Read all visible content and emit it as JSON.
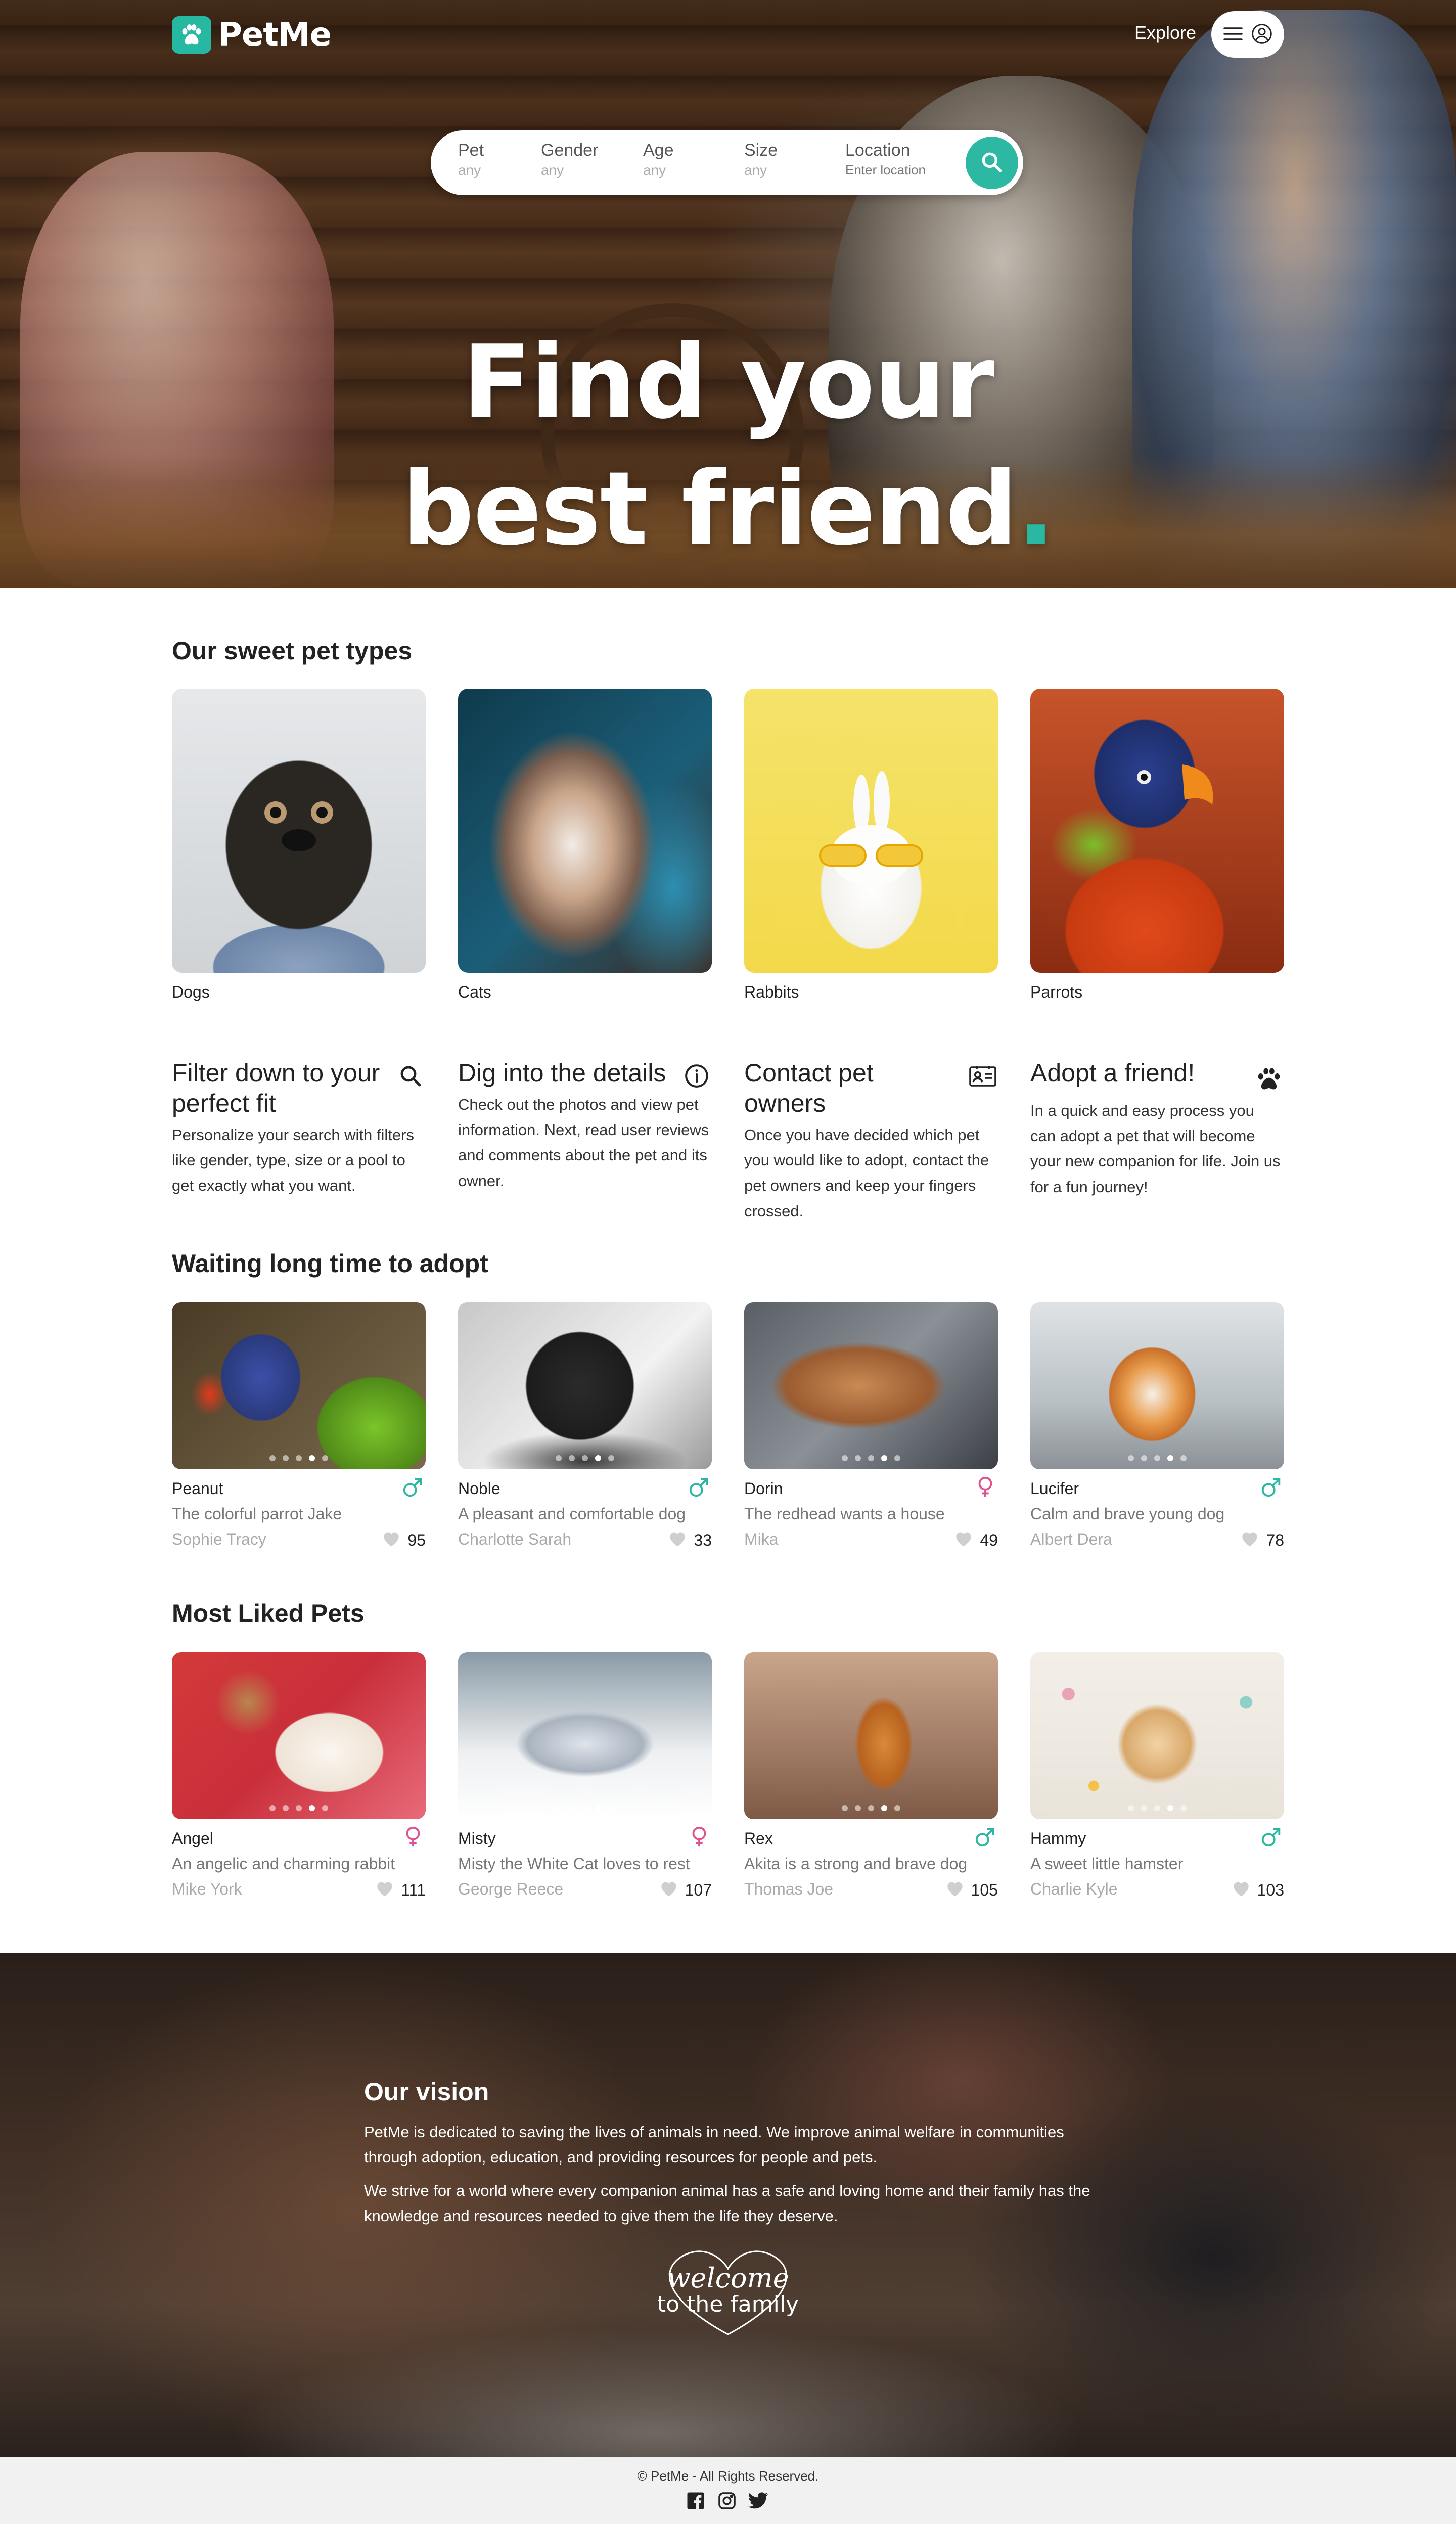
{
  "header": {
    "logo_text": "PetMe",
    "explore_label": "Explore",
    "icons": [
      "paw-icon",
      "hamburger-menu-icon",
      "user-icon"
    ]
  },
  "search": {
    "fields": [
      {
        "label": "Pet",
        "value": "any"
      },
      {
        "label": "Gender",
        "value": "any"
      },
      {
        "label": "Age",
        "value": "any"
      },
      {
        "label": "Size",
        "value": "any"
      },
      {
        "label": "Location",
        "value": "Enter location"
      }
    ],
    "button_icon": "search-icon"
  },
  "hero": {
    "line1": "Find your",
    "line2": "best friend",
    "dot": "."
  },
  "pet_types": {
    "title": "Our sweet pet types",
    "items": [
      {
        "label": "Dogs"
      },
      {
        "label": "Cats"
      },
      {
        "label": "Rabbits"
      },
      {
        "label": "Parrots"
      }
    ]
  },
  "features": [
    {
      "title": "Filter down to your perfect fit",
      "body": "Personalize your search with filters like gender, type, size or a pool to get exactly what you want.",
      "icon": "search-icon"
    },
    {
      "title": "Dig into the details",
      "body": "Check out the photos and view pet information. Next, read user reviews and comments about the pet and its owner.",
      "icon": "info-icon"
    },
    {
      "title": "Contact pet owners",
      "body": "Once you have decided which pet you would like to adopt, contact the pet owners and keep your fingers crossed.",
      "icon": "contact-card-icon"
    },
    {
      "title": "Adopt a friend!",
      "body": "In a quick and easy process you can adopt a pet that will become your new companion for life. Join us for a fun journey!",
      "icon": "paw-icon"
    }
  ],
  "waiting": {
    "title": "Waiting long time to adopt",
    "pets": [
      {
        "name": "Peanut",
        "desc": "The colorful parrot Jake",
        "owner": "Sophie Tracy",
        "likes": "95",
        "sex": "male"
      },
      {
        "name": "Noble",
        "desc": "A pleasant and comfortable dog",
        "owner": "Charlotte Sarah",
        "likes": "33",
        "sex": "male"
      },
      {
        "name": "Dorin",
        "desc": "The redhead wants a house",
        "owner": "Mika",
        "likes": "49",
        "sex": "female"
      },
      {
        "name": "Lucifer",
        "desc": "Calm and brave young dog",
        "owner": "Albert Dera",
        "likes": "78",
        "sex": "male"
      }
    ]
  },
  "liked": {
    "title": "Most Liked Pets",
    "pets": [
      {
        "name": "Angel",
        "desc": "An angelic and charming rabbit",
        "owner": "Mike York",
        "likes": "111",
        "sex": "female"
      },
      {
        "name": "Misty",
        "desc": "Misty the White Cat loves to rest",
        "owner": "George Reece",
        "likes": "107",
        "sex": "female"
      },
      {
        "name": "Rex",
        "desc": "Akita is a strong and brave dog",
        "owner": "Thomas Joe",
        "likes": "105",
        "sex": "male"
      },
      {
        "name": "Hammy",
        "desc": "A sweet little hamster",
        "owner": "Charlie Kyle",
        "likes": "103",
        "sex": "male"
      }
    ]
  },
  "vision": {
    "title": "Our vision",
    "p1": "PetMe is dedicated to saving the lives of animals in need. We improve animal welfare in communities through adoption, education, and providing resources for people and pets.",
    "p2": "We strive for a world where every companion animal has a safe and loving home and their family has the knowledge and resources needed to give them the life they deserve.",
    "welcome_line1": "welcome",
    "welcome_line2": "to the family"
  },
  "footer": {
    "copyright": "© PetMe - All Rights Reserved.",
    "social_icons": [
      "facebook-icon",
      "instagram-icon",
      "twitter-icon"
    ]
  },
  "colors": {
    "accent": "#2bb8a2",
    "male": "#2bb8a2",
    "female": "#e0508f",
    "heart": "#cfcfcf"
  }
}
